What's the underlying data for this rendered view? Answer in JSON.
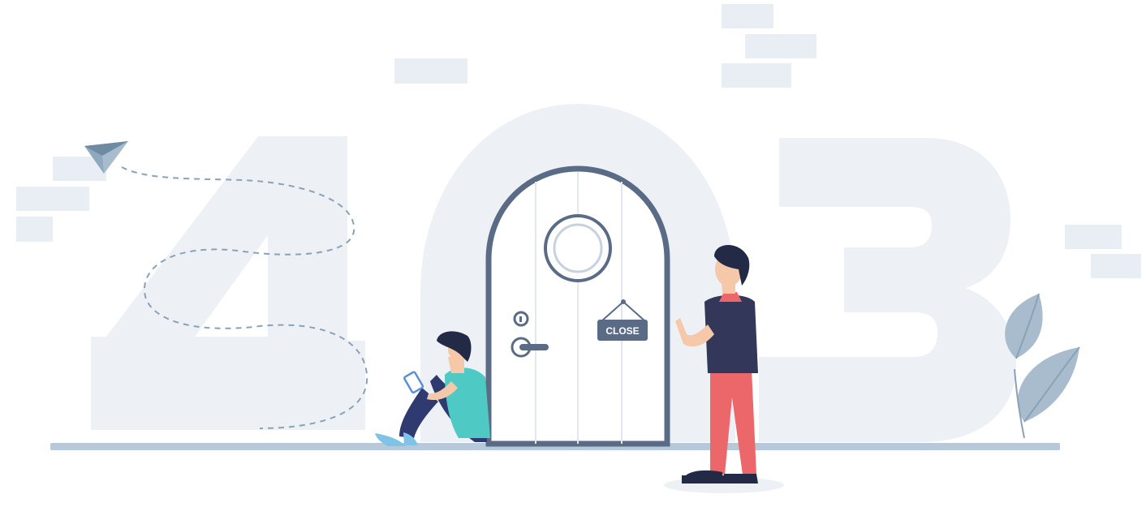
{
  "error_code_digits": [
    "4",
    "0",
    "3"
  ],
  "door_sign": {
    "label": "CLOSE"
  },
  "colors": {
    "background": "#ffffff",
    "digit_fill": "#edf1f5",
    "brick_fill": "#e9eef4",
    "door_fill": "#ffffff",
    "door_frame": "#5a6b85",
    "floor": "#b7c8d8",
    "sign_fill": "#5a6b85",
    "leaf": "#a9bccd",
    "shirt_teal": "#4fc9c3",
    "shirt_navy": "#333759",
    "pants_red": "#eb6769",
    "pants_navy": "#2e3a70",
    "hair": "#232a45",
    "skin": "#f4c8a8"
  },
  "icons": [
    "paper-plane-icon",
    "leaf-icon",
    "door-icon",
    "close-sign-icon"
  ]
}
